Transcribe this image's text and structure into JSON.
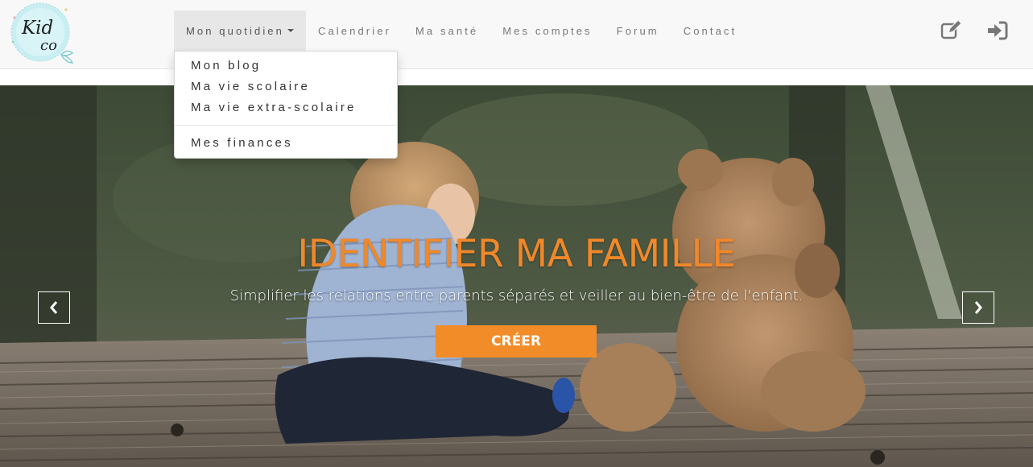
{
  "brand": {
    "logo_text_top": "Kid",
    "logo_text_bottom": "co",
    "logo_icon": "kidco-logo"
  },
  "nav": {
    "items": [
      {
        "label": "Mon quotidien",
        "open": true
      },
      {
        "label": "Calendrier"
      },
      {
        "label": "Ma santé"
      },
      {
        "label": "Mes comptes"
      },
      {
        "label": "Forum"
      },
      {
        "label": "Contact"
      }
    ],
    "icons": [
      "edit-icon",
      "sign-in-icon"
    ]
  },
  "dropdown": {
    "items": [
      "Mon blog",
      "Ma vie scolaire",
      "Ma vie extra-scolaire"
    ],
    "items_after_divider": [
      "Mes finances"
    ]
  },
  "hero": {
    "title": "IDENTIFIER MA FAMILLE",
    "subtitle": "Simplifier les relations entre parents séparés et veiller au bien-être de l'enfant.",
    "button_label": "CRÉER",
    "prev_icon": "chevron-left-icon",
    "next_icon": "chevron-right-icon"
  },
  "colors": {
    "accent": "#f28c28",
    "title": "#f0882a",
    "nav_bg": "#f8f8f8"
  }
}
